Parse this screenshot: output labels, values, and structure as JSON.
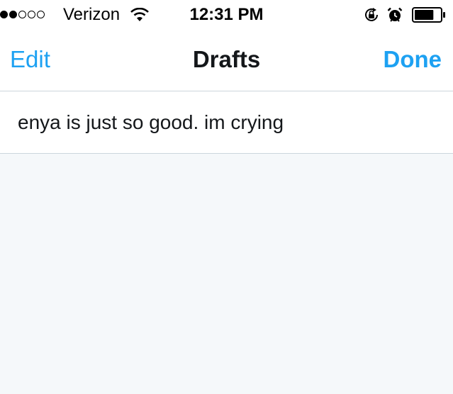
{
  "status_bar": {
    "signal_strength": 2,
    "signal_dots": 5,
    "carrier": "Verizon",
    "wifi_icon": "wifi-icon",
    "time": "12:31 PM",
    "rotation_lock_icon": "rotation-lock-icon",
    "alarm_icon": "alarm-icon",
    "battery_level": 0.75
  },
  "nav": {
    "left_label": "Edit",
    "title": "Drafts",
    "right_label": "Done"
  },
  "drafts": [
    {
      "text": "enya is just so good. im crying"
    }
  ],
  "colors": {
    "accent": "#1da1f2",
    "text": "#14171a",
    "divider": "#ccd6dd",
    "background": "#f5f8fa"
  }
}
